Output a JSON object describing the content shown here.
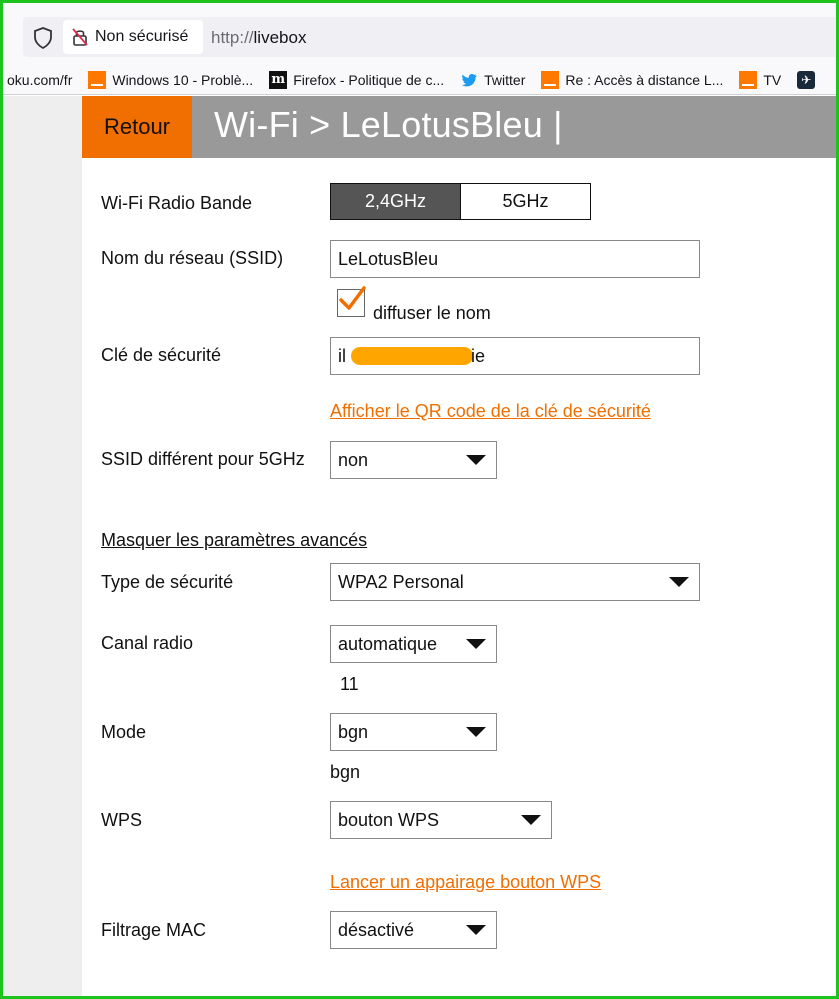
{
  "browser": {
    "secure_label": "Non sécurisé",
    "url_protocol": "http://",
    "url_host": "livebox",
    "bookmarks": [
      {
        "label": "oku.com/fr",
        "icon": "none"
      },
      {
        "label": "Windows 10 - Problè...",
        "icon": "orange-icon"
      },
      {
        "label": "Firefox - Politique de c...",
        "icon": "m-icon"
      },
      {
        "label": "Twitter",
        "icon": "twitter-icon"
      },
      {
        "label": "Re : Accès à distance L...",
        "icon": "orange-icon"
      },
      {
        "label": "TV",
        "icon": "orange-icon"
      }
    ]
  },
  "header": {
    "back_label": "Retour",
    "title": "Wi-Fi > LeLotusBleu |"
  },
  "form": {
    "band_label": "Wi-Fi Radio Bande",
    "band_options": [
      "2,4GHz",
      "5GHz"
    ],
    "band_selected": "2,4GHz",
    "ssid_label": "Nom du réseau (SSID)",
    "ssid_value": "LeLotusBleu",
    "broadcast_label": "diffuser le nom",
    "broadcast_checked": true,
    "key_label": "Clé de sécurité",
    "key_prefix": "il",
    "key_suffix": "ie",
    "qr_link": "Afficher le QR code de la clé de sécurité",
    "ssid5_label": "SSID différent pour 5GHz",
    "ssid5_value": "non",
    "advanced_link": "Masquer les paramètres avancés",
    "security_type_label": "Type de sécurité",
    "security_type_value": "WPA2 Personal",
    "channel_label": "Canal radio",
    "channel_value": "automatique",
    "channel_current": "11",
    "mode_label": "Mode",
    "mode_value": "bgn",
    "mode_current": "bgn",
    "wps_label": "WPS",
    "wps_value": "bouton WPS",
    "wps_link": "Lancer un appairage bouton WPS",
    "mac_label": "Filtrage MAC",
    "mac_value": "désactivé"
  },
  "colors": {
    "accent": "#f16e00",
    "header_bg": "#999999",
    "band_active": "#555555"
  }
}
